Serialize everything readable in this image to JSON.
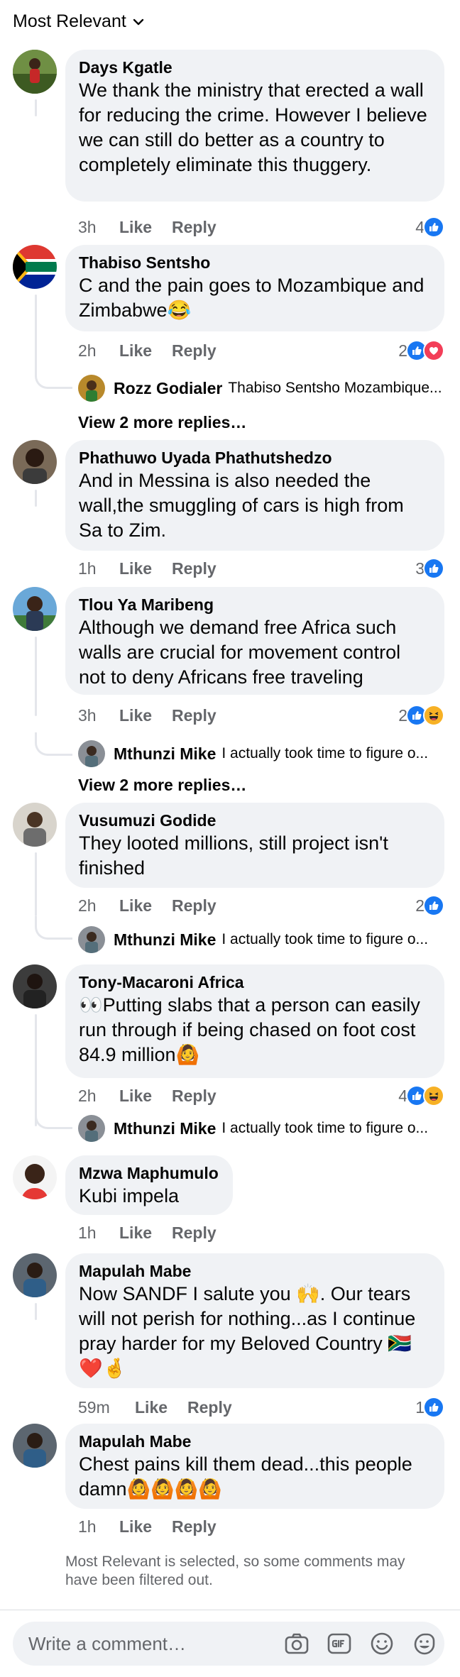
{
  "sort": {
    "label": "Most Relevant"
  },
  "comments": [
    {
      "author": "Days Kgatle",
      "text": "We thank the ministry that erected a wall for reducing the crime. However I believe we can still do better as a country to completely eliminate this thuggery.",
      "time": "3h",
      "like": "Like",
      "reply": "Reply",
      "reactions": {
        "count": "4",
        "types": [
          "like"
        ]
      }
    },
    {
      "author": "Thabiso Sentsho",
      "text": "C and the pain goes to Mozambique and Zimbabwe😂",
      "time": "2h",
      "like": "Like",
      "reply": "Reply",
      "reactions": {
        "count": "2",
        "types": [
          "like",
          "love"
        ]
      },
      "reply_preview": {
        "name": "Rozz Godialer",
        "text": "Thabiso Sentsho Mozambique..."
      },
      "more_replies": "View 2 more replies…"
    },
    {
      "author": "Phathuwo Uyada Phathutshedzo",
      "text": "And in Messina is also needed the wall,the smuggling of cars is high from Sa to Zim.",
      "time": "1h",
      "like": "Like",
      "reply": "Reply",
      "reactions": {
        "count": "3",
        "types": [
          "like"
        ]
      }
    },
    {
      "author": "Tlou Ya Maribeng",
      "text": "Although we demand free Africa such walls are crucial for movement control not to deny Africans free traveling",
      "time": "3h",
      "like": "Like",
      "reply": "Reply",
      "reactions": {
        "count": "2",
        "types": [
          "like",
          "haha"
        ]
      },
      "reply_preview": {
        "name": "Mthunzi Mike",
        "text": "I actually took time to figure o..."
      },
      "more_replies": "View 2 more replies…"
    },
    {
      "author": "Vusumuzi Godide",
      "text": "They looted millions, still project isn't finished",
      "time": "2h",
      "like": "Like",
      "reply": "Reply",
      "reactions": {
        "count": "2",
        "types": [
          "like"
        ]
      },
      "reply_preview": {
        "name": "Mthunzi Mike",
        "text": "I actually took time to figure o..."
      }
    },
    {
      "author": "Tony-Macaroni Africa",
      "text": "👀Putting slabs that a person can easily run through if being chased on foot cost 84.9 million🙆",
      "time": "2h",
      "like": "Like",
      "reply": "Reply",
      "reactions": {
        "count": "4",
        "types": [
          "like",
          "haha"
        ]
      },
      "reply_preview": {
        "name": "Mthunzi Mike",
        "text": "I actually took time to figure o..."
      }
    },
    {
      "author": "Mzwa Maphumulo",
      "text": "Kubi impela",
      "time": "1h",
      "like": "Like",
      "reply": "Reply"
    },
    {
      "author": "Mapulah Mabe",
      "text": "Now SANDF I salute you 🙌. Our tears will not perish for nothing...as I continue pray harder for my Beloved Country 🇿🇦 ❤️🤞",
      "time": "59m",
      "like": "Like",
      "reply": "Reply",
      "reactions": {
        "count": "1",
        "types": [
          "like"
        ]
      }
    },
    {
      "author": "Mapulah Mabe",
      "text": "Chest pains kill them dead...this people damn🙆🙆🙆🙆",
      "time": "1h",
      "like": "Like",
      "reply": "Reply"
    }
  ],
  "footer_note": "Most Relevant is selected, so some comments may have been filtered out.",
  "composer": {
    "placeholder": "Write a comment…"
  },
  "colors": {
    "like_blue": "#1877f2",
    "love_red": "#f33e58",
    "haha_yellow": "#f7b125",
    "meta_gray": "#65676b",
    "bubble": "#f0f2f5"
  },
  "icons": [
    "chevron-down-icon",
    "like-reaction-icon",
    "love-reaction-icon",
    "haha-reaction-icon",
    "camera-icon",
    "gif-icon",
    "emoji-icon",
    "sticker-icon"
  ]
}
